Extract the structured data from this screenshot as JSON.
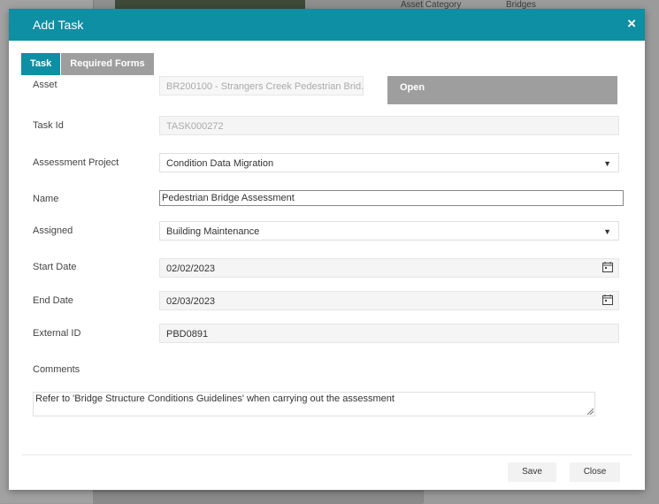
{
  "background": {
    "panel_label_1": "Asset Category",
    "panel_value_1": "Bridges"
  },
  "modal": {
    "title": "Add Task",
    "close_glyph": "×"
  },
  "tabs": [
    {
      "label": "Task",
      "active": true
    },
    {
      "label": "Required Forms",
      "active": false
    }
  ],
  "form": {
    "asset": {
      "label": "Asset",
      "value": "BR200100 - Strangers Creek Pedestrian Brid..."
    },
    "status": {
      "value": "Open"
    },
    "task_id": {
      "label": "Task Id",
      "value": "TASK000272"
    },
    "assessment_project": {
      "label": "Assessment Project",
      "value": "Condition Data Migration"
    },
    "name": {
      "label": "Name",
      "value": "Pedestrian Bridge Assessment"
    },
    "assigned": {
      "label": "Assigned",
      "value": "Building Maintenance"
    },
    "start_date": {
      "label": "Start Date",
      "value": "02/02/2023"
    },
    "end_date": {
      "label": "End Date",
      "value": "02/03/2023"
    },
    "external_id": {
      "label": "External ID",
      "value": "PBD0891"
    },
    "comments": {
      "label": "Comments",
      "value": "Refer to 'Bridge Structure Conditions Guidelines' when carrying out the assessment"
    }
  },
  "footer": {
    "save_label": "Save",
    "close_label": "Close"
  },
  "colors": {
    "accent": "#0e8fa3",
    "inactive_tab": "#9e9e9e"
  }
}
